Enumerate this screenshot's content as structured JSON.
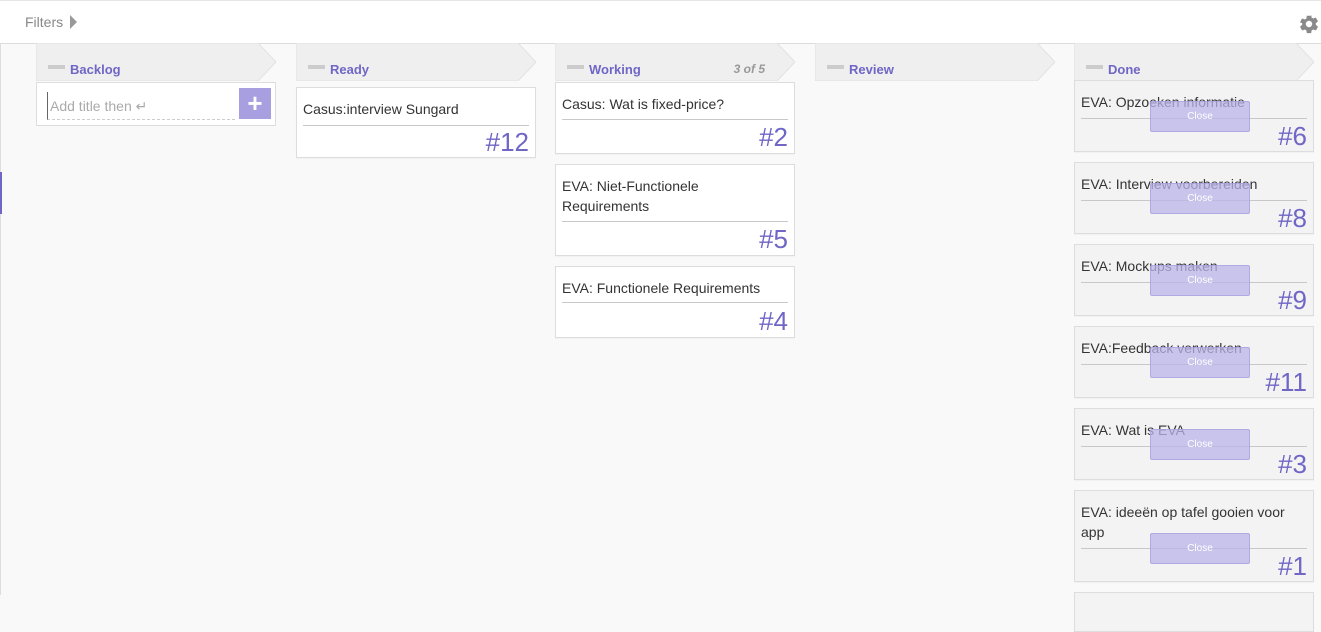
{
  "topbar": {
    "filters_label": "Filters",
    "filters_icon": "caret-right-icon",
    "settings_icon": "gear-icon"
  },
  "colors": {
    "accent": "#6f66c6",
    "close_button": "#bab4e8",
    "header_band": "#efefef"
  },
  "columns": [
    {
      "name": "Backlog",
      "count": "",
      "add_placeholder": "Add title then ↵",
      "add_button": "+",
      "cards": []
    },
    {
      "name": "Ready",
      "count": "",
      "cards": [
        {
          "title": "Casus:interview Sungard",
          "number": "#12"
        }
      ]
    },
    {
      "name": "Working",
      "count": "3 of 5",
      "cards": [
        {
          "title": "Casus: Wat is fixed-price?",
          "number": "#2"
        },
        {
          "title": "EVA: Niet-Functionele Requirements",
          "number": "#5"
        },
        {
          "title": "EVA: Functionele Requirements",
          "number": "#4"
        }
      ]
    },
    {
      "name": "Review",
      "count": "",
      "cards": []
    },
    {
      "name": "Done",
      "count": "",
      "cards": [
        {
          "title": "EVA: Opzoeken informatie",
          "number": "#6",
          "close_label": "Close"
        },
        {
          "title": "EVA: Interview voorbereiden",
          "number": "#8",
          "close_label": "Close"
        },
        {
          "title": "EVA: Mockups maken",
          "number": "#9",
          "close_label": "Close"
        },
        {
          "title": "EVA:Feedback verwerken",
          "number": "#11",
          "close_label": "Close"
        },
        {
          "title": "EVA: Wat is EVA",
          "number": "#3",
          "close_label": "Close"
        },
        {
          "title": "EVA: ideeën op tafel gooien voor app",
          "number": "#1",
          "close_label": "Close"
        }
      ]
    }
  ]
}
